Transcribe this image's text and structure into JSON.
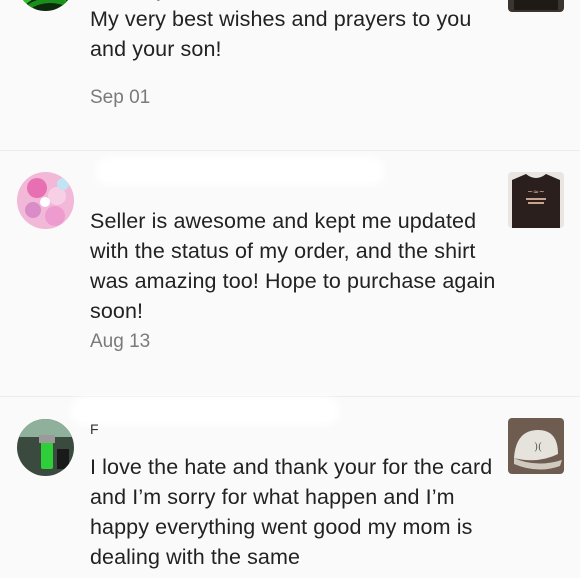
{
  "reviews": [
    {
      "name": "",
      "text": "Thank you for the shirt and the bracelet. My very best wishes and prayers to you and your son!",
      "date": "Sep 01",
      "avatar_icon": "green-plant-avatar-icon",
      "item_icon": "item-thumbnail-icon"
    },
    {
      "name": "",
      "text": "Seller is awesome and kept me updated with the status of my order, and the shirt was amazing too! Hope to purchase again soon!",
      "date": "Aug 13",
      "avatar_icon": "pink-floral-avatar-icon",
      "item_icon": "black-tshirt-thumbnail-icon"
    },
    {
      "name": "F",
      "text": "I love the hate and thank your for the card and I’m sorry for what happen and I’m happy everything went good my mom is dealing with the same",
      "date": "",
      "avatar_icon": "lighter-avatar-icon",
      "item_icon": "white-cap-thumbnail-icon"
    }
  ],
  "colors": {
    "background": "#fafafa",
    "text": "#222222",
    "date": "#7a7a7a",
    "divider": "#ececec"
  }
}
